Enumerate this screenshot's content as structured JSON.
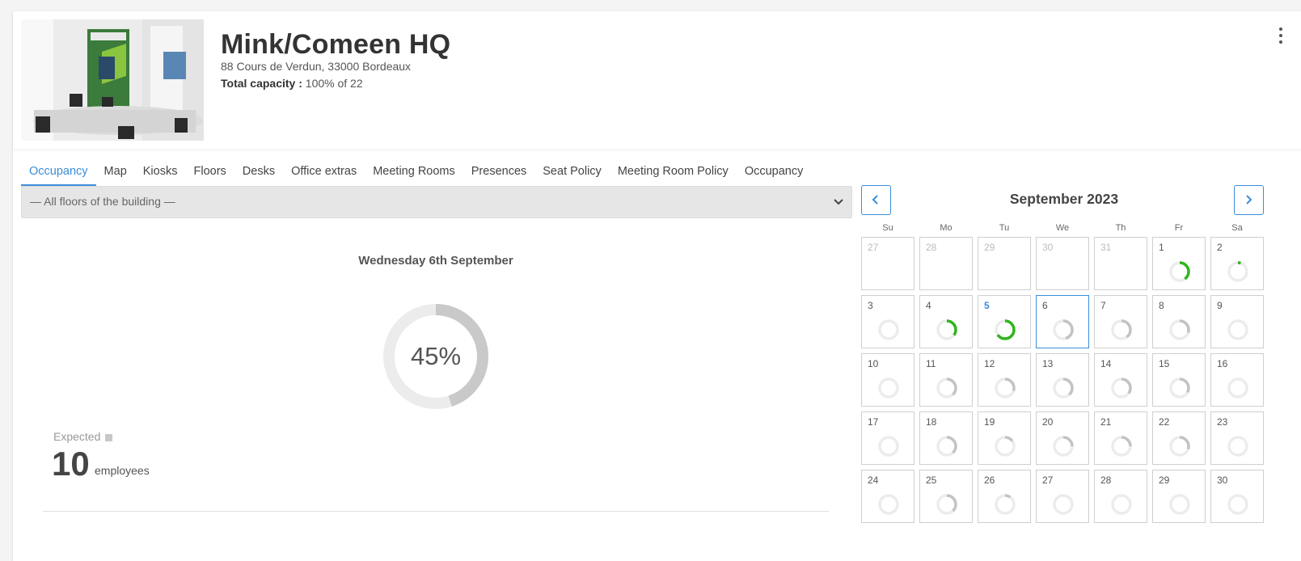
{
  "header": {
    "title": "Mink/Comeen HQ",
    "address": "88 Cours de Verdun, 33000 Bordeaux",
    "capacity_label": "Total capacity :",
    "capacity_value": "100% of 22"
  },
  "tabs": [
    "Occupancy",
    "Map",
    "Kiosks",
    "Floors",
    "Desks",
    "Office extras",
    "Meeting Rooms",
    "Presences",
    "Seat Policy",
    "Meeting Room Policy",
    "Occupancy"
  ],
  "floor_filter": {
    "selected": "— All floors of the building —"
  },
  "day": {
    "title": "Wednesday 6th September",
    "occupancy_pct": 45,
    "occupancy_label": "45%",
    "expected_label": "Expected",
    "expected_count": "10",
    "expected_unit": "employees"
  },
  "calendar": {
    "month_label": "September 2023",
    "weekdays": [
      "Su",
      "Mo",
      "Tu",
      "We",
      "Th",
      "Fr",
      "Sa"
    ],
    "colors": {
      "accent": "#3a8dd8",
      "green": "#2fb51c",
      "grey": "#c3c3c3",
      "track": "#ececec"
    },
    "days": [
      {
        "n": "27",
        "other": true,
        "occ": null,
        "c": "grey"
      },
      {
        "n": "28",
        "other": true,
        "occ": null,
        "c": "grey"
      },
      {
        "n": "29",
        "other": true,
        "occ": null,
        "c": "grey"
      },
      {
        "n": "30",
        "other": true,
        "occ": null,
        "c": "grey"
      },
      {
        "n": "31",
        "other": true,
        "occ": null,
        "c": "grey"
      },
      {
        "n": "1",
        "occ": 0.4,
        "c": "green"
      },
      {
        "n": "2",
        "occ": 0.05,
        "c": "green"
      },
      {
        "n": "3",
        "occ": 0,
        "c": "grey"
      },
      {
        "n": "4",
        "occ": 0.35,
        "c": "green"
      },
      {
        "n": "5",
        "occ": 0.65,
        "c": "green",
        "today": true
      },
      {
        "n": "6",
        "occ": 0.45,
        "c": "grey",
        "selected": true
      },
      {
        "n": "7",
        "occ": 0.4,
        "c": "grey"
      },
      {
        "n": "8",
        "occ": 0.3,
        "c": "grey"
      },
      {
        "n": "9",
        "occ": 0,
        "c": "grey"
      },
      {
        "n": "10",
        "occ": 0,
        "c": "grey"
      },
      {
        "n": "11",
        "occ": 0.38,
        "c": "grey"
      },
      {
        "n": "12",
        "occ": 0.3,
        "c": "grey"
      },
      {
        "n": "13",
        "occ": 0.38,
        "c": "grey"
      },
      {
        "n": "14",
        "occ": 0.35,
        "c": "grey"
      },
      {
        "n": "15",
        "occ": 0.33,
        "c": "grey"
      },
      {
        "n": "16",
        "occ": 0,
        "c": "grey"
      },
      {
        "n": "17",
        "occ": 0,
        "c": "grey"
      },
      {
        "n": "18",
        "occ": 0.38,
        "c": "grey"
      },
      {
        "n": "19",
        "occ": 0.15,
        "c": "grey"
      },
      {
        "n": "20",
        "occ": 0.25,
        "c": "grey"
      },
      {
        "n": "21",
        "occ": 0.25,
        "c": "grey"
      },
      {
        "n": "22",
        "occ": 0.3,
        "c": "grey"
      },
      {
        "n": "23",
        "occ": 0,
        "c": "grey"
      },
      {
        "n": "24",
        "occ": 0,
        "c": "grey"
      },
      {
        "n": "25",
        "occ": 0.38,
        "c": "grey"
      },
      {
        "n": "26",
        "occ": 0.1,
        "c": "grey"
      },
      {
        "n": "27",
        "occ": 0,
        "c": "grey"
      },
      {
        "n": "28",
        "occ": 0,
        "c": "grey"
      },
      {
        "n": "29",
        "occ": 0,
        "c": "grey"
      },
      {
        "n": "30",
        "occ": 0,
        "c": "grey"
      }
    ]
  }
}
